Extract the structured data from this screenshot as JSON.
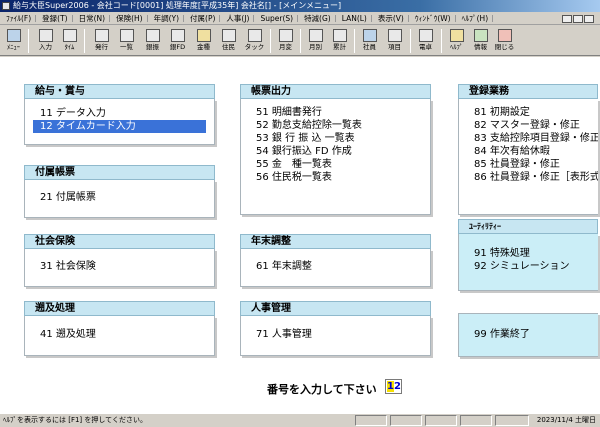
{
  "window": {
    "title": "給与大臣Super2006 - 会社コード[0001] 処理年度[平成35年] 会社名[] - [メインメニュー]"
  },
  "menubar": {
    "items": [
      "ﾌｧｲﾙ(F)",
      "登録(T)",
      "日常(N)",
      "保険(H)",
      "年調(Y)",
      "付属(P)",
      "人事(J)",
      "Super(S)",
      "特減(G)",
      "LAN(L)",
      "表示(V)",
      "ｳｨﾝﾄﾞｳ(W)",
      "ﾍﾙﾌﾟ(H)"
    ]
  },
  "toolbar": {
    "buttons": [
      "ﾒﾆｭｰ",
      "入力",
      "ﾀｲﾑ",
      "発行",
      "一覧",
      "銀振",
      "銀FD",
      "金種",
      "住民",
      "タック",
      "月変",
      "月別",
      "累計",
      "社員",
      "項目",
      "電卓",
      "ﾍﾙﾌﾟ",
      "情報",
      "閉じる"
    ]
  },
  "panels": {
    "kyuyo": {
      "title": "給与・賞与",
      "items": [
        "11 データ入力",
        "12 タイムカード入力"
      ]
    },
    "fuzoku": {
      "title": "付属帳票",
      "items": [
        "21 付属帳票"
      ]
    },
    "shakai": {
      "title": "社会保険",
      "items": [
        "31 社会保険"
      ]
    },
    "sokyu": {
      "title": "遡及処理",
      "items": [
        "41 遡及処理"
      ]
    },
    "chohyo": {
      "title": "帳票出力",
      "items": [
        "51 明細書発行",
        "52 勤怠支給控除一覧表",
        "53 銀 行 振 込 一覧表",
        "54 銀行振込 FD 作成",
        "55 金　種一覧表",
        "56 住民税一覧表"
      ]
    },
    "nenmatsu": {
      "title": "年末調整",
      "items": [
        "61 年末調整"
      ]
    },
    "jinji": {
      "title": "人事管理",
      "items": [
        "71 人事管理"
      ]
    },
    "toroku": {
      "title": "登録業務",
      "items": [
        "81 初期設定",
        "82 マスター登録・修正",
        "83 支給控除項目登録・修正",
        "84 年次有給休暇",
        "85 社員登録・修正",
        "86 社員登録・修正［表形式］"
      ]
    },
    "utility": {
      "title": "ﾕｰﾃｨﾘﾃｨｰ",
      "items": [
        "91 特殊処理",
        "92 シミュレーション"
      ]
    },
    "shuryo": {
      "items": [
        "99 作業終了"
      ]
    }
  },
  "prompt": {
    "label": "番号を入力して下さい",
    "value": "12"
  },
  "statusbar": {
    "message": "ﾍﾙﾌﾟを表示するには [F1] を押してください。",
    "date": "2023/11/4 土曜日"
  }
}
